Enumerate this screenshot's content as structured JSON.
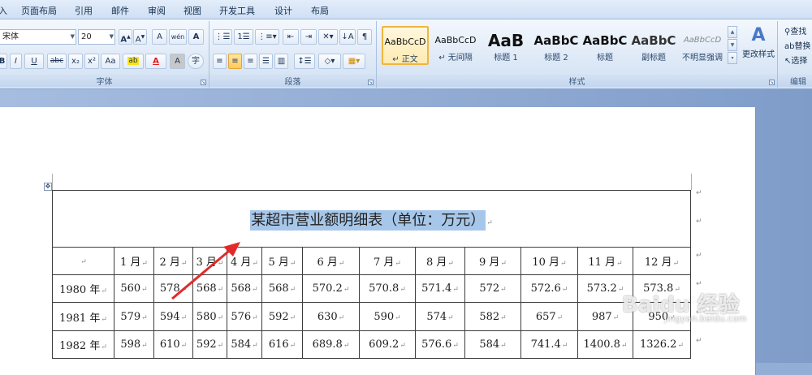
{
  "tabs": [
    "入",
    "页面布局",
    "引用",
    "邮件",
    "审阅",
    "视图",
    "开发工具",
    "设计",
    "布局"
  ],
  "font_group": {
    "font_name": "宋体",
    "font_size": "20",
    "label": "字体",
    "grow_btn": "A",
    "shrink_btn": "A",
    "clear_btn": "A",
    "pinyin_btn": "wén",
    "border_char_btn": "A",
    "bold": "B",
    "italic": "I",
    "underline": "U",
    "strike": "abc",
    "sub": "x₂",
    "sup": "x²",
    "case_btn": "Aa",
    "highlight_btn": "ab",
    "color_btn": "A",
    "shade_btn": "A",
    "circle_btn": "字"
  },
  "para_group": {
    "label": "段落"
  },
  "styles_group": {
    "label": "样式",
    "change_styles": "更改样式",
    "items": [
      {
        "preview": "AaBbCcD",
        "name": "正文"
      },
      {
        "preview": "AaBbCcD",
        "name": "无间隔"
      },
      {
        "preview": "AaB",
        "name": "标题 1"
      },
      {
        "preview": "AaBbC",
        "name": "标题 2"
      },
      {
        "preview": "AaBbC",
        "name": "标题"
      },
      {
        "preview": "AaBbC",
        "name": "副标题"
      },
      {
        "preview": "AaBbCcD",
        "name": "不明显强调"
      }
    ]
  },
  "edit_group": {
    "label": "编辑",
    "find": "查找",
    "replace": "替换",
    "select": "选择"
  },
  "table": {
    "title": "某超市营业额明细表（单位：万元）",
    "header": [
      "",
      "1 月",
      "2 月",
      "3 月",
      "4 月",
      "5 月",
      "6 月",
      "7 月",
      "8 月",
      "9 月",
      "10 月",
      "11 月",
      "12 月"
    ],
    "rows": [
      [
        "1980 年",
        "560",
        "578",
        "568",
        "568",
        "568",
        "570.2",
        "570.8",
        "571.4",
        "572",
        "572.6",
        "573.2",
        "573.8"
      ],
      [
        "1981 年",
        "579",
        "594",
        "580",
        "576",
        "592",
        "630",
        "590",
        "574",
        "582",
        "657",
        "987",
        "950"
      ],
      [
        "1982 年",
        "598",
        "610",
        "592",
        "584",
        "616",
        "689.8",
        "609.2",
        "576.6",
        "584",
        "741.4",
        "1400.8",
        "1326.2"
      ]
    ]
  },
  "watermark": {
    "text": "Baidu 经验",
    "sub": "jingyan.baidu.com"
  },
  "colors": {
    "highlight": "#f8e21a",
    "font_color": "#e11b1b",
    "selection": "#a7c7ea",
    "arrow": "#e32a2a"
  }
}
